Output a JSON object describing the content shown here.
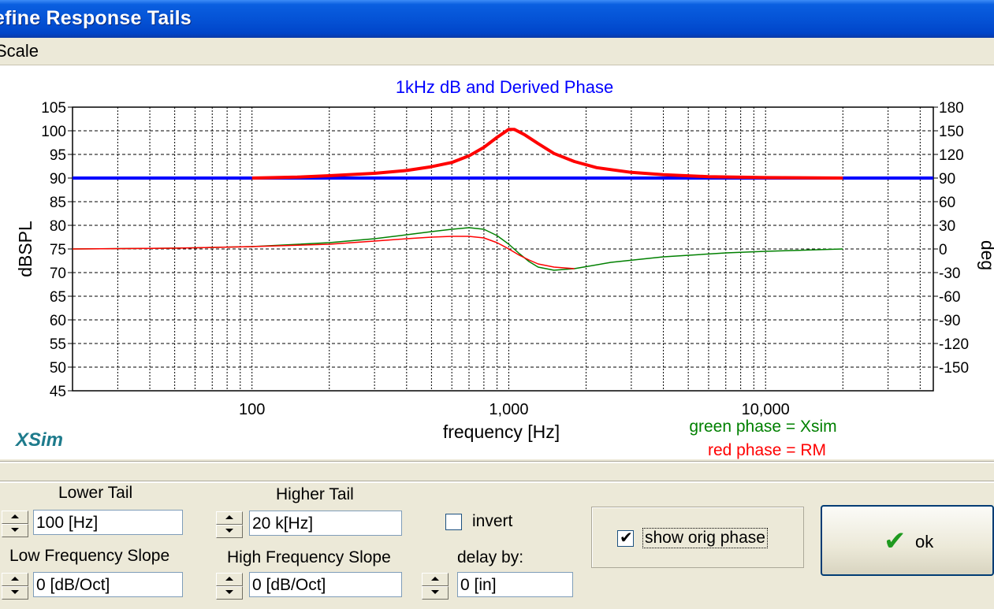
{
  "window": {
    "title": "efine Response Tails"
  },
  "menu": {
    "items": [
      "Scale"
    ]
  },
  "brand": "XSim",
  "colors": {
    "magnitude": "#ff0000",
    "magnitude_tail": "#0000ff",
    "phase_xsim": "#008000",
    "phase_rm": "#ff0000",
    "title": "#0000ff"
  },
  "chart_data": {
    "type": "line",
    "title": "1kHz dB and Derived Phase",
    "xlabel": "frequency [Hz]",
    "ylabel": "dBSPL",
    "y2label": "deg",
    "xscale": "log",
    "xlim": [
      20,
      45000
    ],
    "ylim": [
      45,
      105
    ],
    "y2lim": [
      -180,
      180
    ],
    "grid": true,
    "x_ticks": [
      {
        "v": 100,
        "label": "100"
      },
      {
        "v": 1000,
        "label": "1,000"
      },
      {
        "v": 10000,
        "label": "10,000"
      }
    ],
    "y_ticks": [
      105,
      100,
      95,
      90,
      85,
      80,
      75,
      70,
      65,
      60,
      55,
      50,
      45
    ],
    "y2_ticks": [
      180,
      150,
      120,
      90,
      60,
      30,
      0,
      -30,
      -60,
      -90,
      -120,
      -150
    ],
    "legend_notes": [
      {
        "text": "green phase = Xsim",
        "color": "#008000"
      },
      {
        "text": "red phase = RM",
        "color": "#ff0000"
      }
    ],
    "series": [
      {
        "axis": "left",
        "color": "#0000ff",
        "width": 4,
        "points": [
          [
            20,
            90
          ],
          [
            100,
            90
          ],
          [
            20000,
            90
          ],
          [
            45000,
            90
          ]
        ]
      },
      {
        "axis": "left",
        "color": "#ff0000",
        "width": 4,
        "points": [
          [
            100,
            90
          ],
          [
            150,
            90.2
          ],
          [
            200,
            90.5
          ],
          [
            300,
            91
          ],
          [
            400,
            91.6
          ],
          [
            500,
            92.4
          ],
          [
            600,
            93.3
          ],
          [
            700,
            94.7
          ],
          [
            800,
            96.5
          ],
          [
            900,
            98.6
          ],
          [
            1000,
            100.3
          ],
          [
            1050,
            100.3
          ],
          [
            1150,
            99.2
          ],
          [
            1300,
            97.3
          ],
          [
            1500,
            95.2
          ],
          [
            1800,
            93.5
          ],
          [
            2200,
            92.2
          ],
          [
            3000,
            91.2
          ],
          [
            4000,
            90.7
          ],
          [
            6000,
            90.3
          ],
          [
            10000,
            90.1
          ],
          [
            20000,
            90
          ]
        ]
      },
      {
        "axis": "right",
        "color": "#008000",
        "width": 1.5,
        "points": [
          [
            20,
            0
          ],
          [
            50,
            1
          ],
          [
            100,
            3
          ],
          [
            200,
            8
          ],
          [
            300,
            13
          ],
          [
            400,
            18
          ],
          [
            500,
            22
          ],
          [
            600,
            25
          ],
          [
            700,
            27
          ],
          [
            800,
            25
          ],
          [
            900,
            17
          ],
          [
            1000,
            6
          ],
          [
            1100,
            -6
          ],
          [
            1200,
            -16
          ],
          [
            1300,
            -23
          ],
          [
            1500,
            -27
          ],
          [
            1800,
            -25
          ],
          [
            2500,
            -17
          ],
          [
            4000,
            -10
          ],
          [
            7000,
            -5
          ],
          [
            10000,
            -3
          ],
          [
            20000,
            0
          ]
        ]
      },
      {
        "axis": "right",
        "color": "#ff0000",
        "width": 1.5,
        "points": [
          [
            20,
            0
          ],
          [
            50,
            1
          ],
          [
            100,
            3
          ],
          [
            200,
            6
          ],
          [
            300,
            10
          ],
          [
            400,
            13
          ],
          [
            500,
            15
          ],
          [
            600,
            16
          ],
          [
            700,
            16
          ],
          [
            800,
            14
          ],
          [
            900,
            8
          ],
          [
            1000,
            0
          ],
          [
            1100,
            -8
          ],
          [
            1200,
            -14
          ],
          [
            1300,
            -19
          ],
          [
            1500,
            -23
          ],
          [
            1800,
            -25
          ]
        ]
      }
    ]
  },
  "controls": {
    "lower_tail": {
      "label": "Lower Tail",
      "value": "100 [Hz]"
    },
    "higher_tail": {
      "label": "Higher Tail",
      "value": "20 k[Hz]"
    },
    "low_slope": {
      "label": "Low Frequency Slope",
      "value": "0 [dB/Oct]"
    },
    "high_slope": {
      "label": "High Frequency Slope",
      "value": "0 [dB/Oct]"
    },
    "invert": {
      "label": "invert",
      "checked": false
    },
    "delay": {
      "label": "delay by:",
      "value": "0 [in]"
    },
    "show_orig_phase": {
      "label": "show orig phase",
      "checked": true,
      "mark": "✔"
    },
    "ok": {
      "label": "ok",
      "mark": "✔"
    }
  }
}
